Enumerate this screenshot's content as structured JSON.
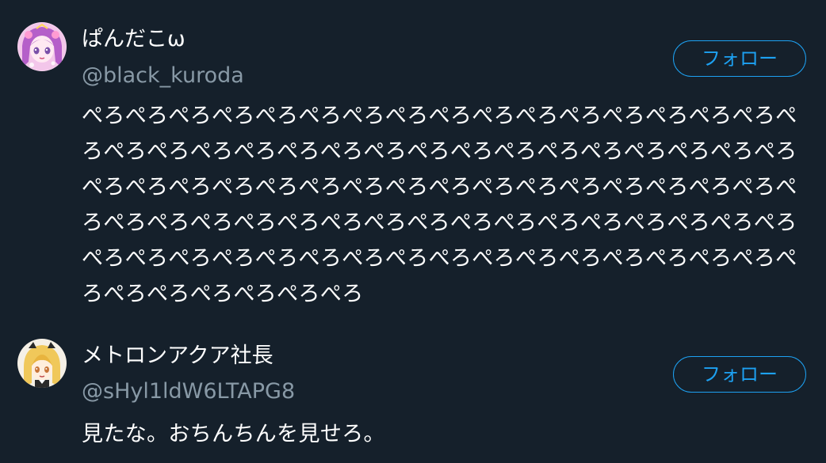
{
  "tweets": [
    {
      "display_name": "ぱんだこω",
      "handle": "@black_kuroda",
      "follow_label": "フォロー",
      "text": "ぺろぺろぺろぺろぺろぺろぺろぺろぺろぺろぺろぺろぺろぺろぺろぺろぺろぺろぺろぺろぺろぺろぺろぺろぺろぺろぺろぺろぺろぺろぺろぺろぺろぺろぺろぺろぺろぺろぺろぺろぺろぺろぺろぺろぺろぺろぺろぺろぺろぺろぺろぺろぺろぺろぺろぺろぺろぺろぺろぺろぺろぺろぺろぺろぺろぺろぺろぺろぺろぺろぺろぺろぺろぺろぺろぺろぺろぺろぺろぺろぺろぺろぺろぺろぺろぺろぺろぺろぺろ",
      "avatar_icon": "anime-girl-pink-avatar-icon",
      "avatar_colors": [
        "#f3c6ea",
        "#c77dd6",
        "#7a4fa8"
      ]
    },
    {
      "display_name": "メトロンアクア社長",
      "handle": "@sHyl1ldW6LTAPG8",
      "follow_label": "フォロー",
      "text": "見たな。おちんちんを見せろ。",
      "avatar_icon": "anime-girl-blonde-avatar-icon",
      "avatar_colors": [
        "#f5f0e6",
        "#f0c85a",
        "#2a2a2a"
      ]
    }
  ],
  "colors": {
    "background": "#15202b",
    "primary_text": "#ffffff",
    "secondary_text": "#8899a6",
    "accent": "#1da1f2"
  }
}
